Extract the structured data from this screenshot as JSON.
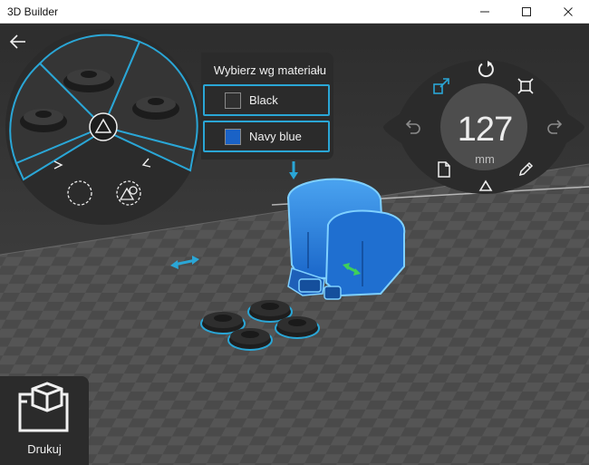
{
  "window": {
    "title": "3D Builder",
    "controls": [
      "minimize",
      "maximize",
      "close"
    ]
  },
  "material_panel": {
    "header": "Wybierz wg materiału",
    "options": [
      {
        "label": "Black",
        "color": "#303030"
      },
      {
        "label": "Navy blue",
        "color": "#1a62c6"
      }
    ]
  },
  "size_control": {
    "value": "127",
    "unit": "mm"
  },
  "print": {
    "label": "Drukuj"
  },
  "colors": {
    "accent": "#2aa6d6",
    "selection_blue": "#1e78d8",
    "panel": "#2b2b2b",
    "scale_handle": "#3fcf5b"
  },
  "icons": [
    "back-arrow-icon",
    "wheel-select-icon",
    "empty-circle-icon",
    "shapes-icon",
    "rotate-icon",
    "move-icon",
    "fit-icon",
    "undo-icon",
    "redo-icon",
    "document-icon",
    "pencil-icon",
    "triangle-icon",
    "print-3d-icon"
  ]
}
